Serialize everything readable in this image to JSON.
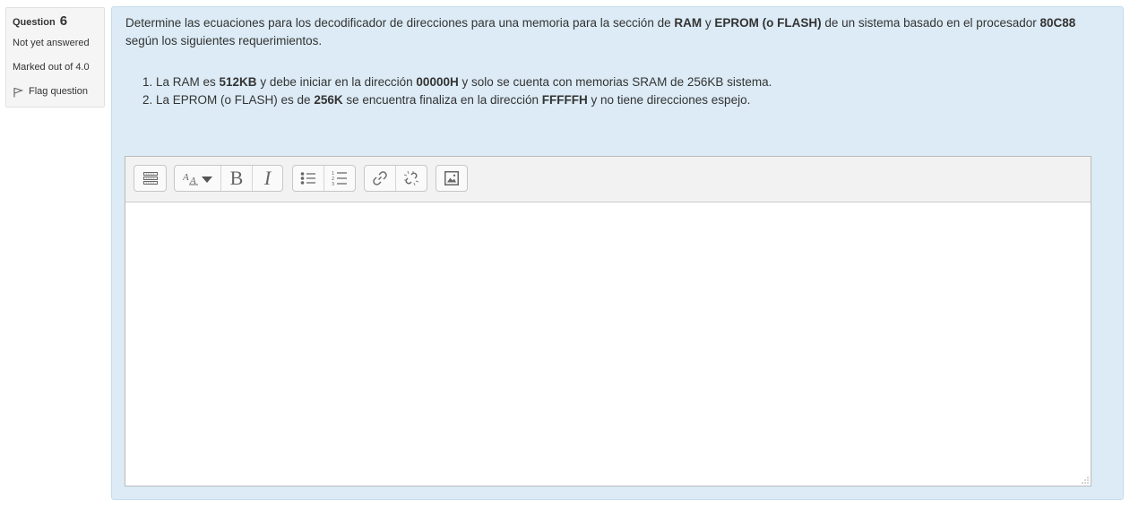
{
  "info": {
    "question_label": "Question",
    "question_number": "6",
    "state": "Not yet answered",
    "grade": "Marked out of 4.0",
    "flag_label": "Flag question"
  },
  "question": {
    "intro": [
      {
        "text": "Determine las ecuaciones para los decodificador de direcciones para una memoria para la sección de ",
        "bold": false
      },
      {
        "text": "RAM",
        "bold": true
      },
      {
        "text": " y ",
        "bold": false
      },
      {
        "text": "EPROM (o FLASH)",
        "bold": true
      },
      {
        "text": " de un sistema basado en el procesador ",
        "bold": false
      },
      {
        "text": "80C88",
        "bold": true
      },
      {
        "text": " según los siguientes requerimientos.",
        "bold": false
      }
    ],
    "items": [
      [
        {
          "text": "La RAM es ",
          "bold": false
        },
        {
          "text": "512KB",
          "bold": true
        },
        {
          "text": " y debe iniciar en la dirección ",
          "bold": false
        },
        {
          "text": "00000H",
          "bold": true
        },
        {
          "text": " y solo se cuenta con memorias SRAM de 256KB sistema.",
          "bold": false
        }
      ],
      [
        {
          "text": "La EPROM (o FLASH) es de ",
          "bold": false
        },
        {
          "text": "256K",
          "bold": true
        },
        {
          "text": " se encuentra finaliza en la dirección ",
          "bold": false
        },
        {
          "text": "FFFFFH",
          "bold": true
        },
        {
          "text": " y no tiene direcciones espejo.",
          "bold": false
        }
      ]
    ]
  },
  "editor": {
    "toolbar": {
      "groups": [
        [
          "toolbar-toggle-icon"
        ],
        [
          "font-style-icon",
          "bold-icon",
          "italic-icon"
        ],
        [
          "unordered-list-icon",
          "ordered-list-icon"
        ],
        [
          "link-icon",
          "unlink-icon"
        ],
        [
          "image-icon"
        ]
      ],
      "bold_glyph": "B",
      "italic_glyph": "I"
    },
    "value": ""
  },
  "colors": {
    "content_bg": "#dcebf5",
    "info_bg": "#f5f5f5",
    "toolbar_bg": "#f2f2f2"
  }
}
